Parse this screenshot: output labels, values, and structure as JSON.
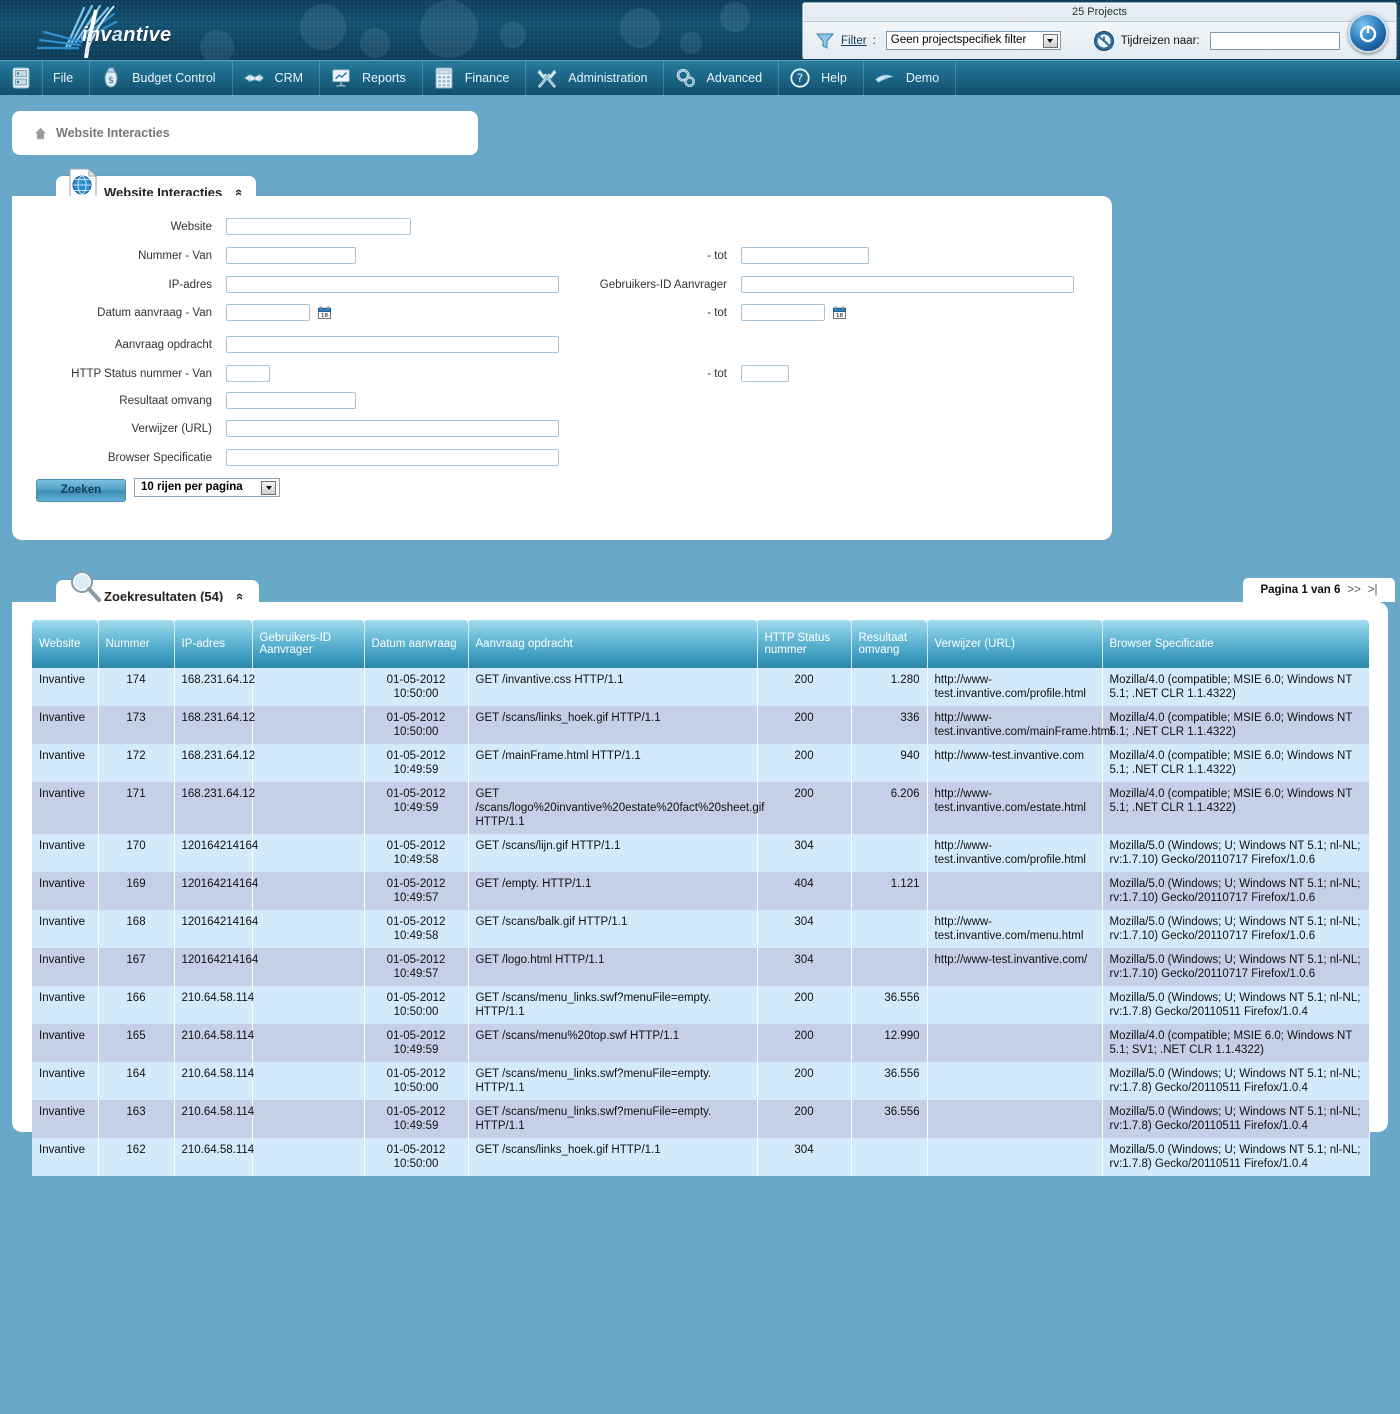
{
  "banner": {
    "logo_text_pre": "inv",
    "logo_text_swirl": "a",
    "logo_text_post": "ntive",
    "logo_full": "invantive"
  },
  "project_panel": {
    "title": "25 Projects",
    "filter_label": "Filter",
    "filter_colon": ":",
    "filter_value": "Geen projectspecifiek filter",
    "timetravel_label": "Tijdreizen naar:",
    "timetravel_value": "",
    "funnel_icon": "funnel-icon",
    "clock_icon": "clock-back-icon",
    "power_icon": "power-icon"
  },
  "menu": {
    "items": [
      {
        "label": "",
        "icon": "server-icon"
      },
      {
        "label": "File",
        "icon": ""
      },
      {
        "label": "Budget Control",
        "icon": "money-bag-icon"
      },
      {
        "label": "CRM",
        "icon": "handshake-icon"
      },
      {
        "label": "Reports",
        "icon": "presentation-chart-icon"
      },
      {
        "label": "Finance",
        "icon": "calculator-icon"
      },
      {
        "label": "Administration",
        "icon": "tools-icon"
      },
      {
        "label": "Advanced",
        "icon": "gears-icon"
      },
      {
        "label": "Help",
        "icon": "question-circle-icon"
      },
      {
        "label": "Demo",
        "icon": "bird-icon"
      }
    ]
  },
  "breadcrumb": {
    "home_icon": "home-icon",
    "text": "Website Interacties"
  },
  "search_panel": {
    "tab_title": "Website Interacties",
    "tab_icon": "globe-document-icon",
    "collapse_chevron": "«",
    "fields": {
      "website_label": "Website",
      "website_value": "",
      "nummer_van_label": "Nummer - Van",
      "nummer_van_value": "",
      "nummer_tot_label": "- tot",
      "nummer_tot_value": "",
      "ip_label": "IP-adres",
      "ip_value": "",
      "gebruikers_label": "Gebruikers-ID Aanvrager",
      "gebruikers_value": "",
      "datum_van_label": "Datum aanvraag - Van",
      "datum_van_value": "",
      "datum_tot_label": "- tot",
      "datum_tot_value": "",
      "opdracht_label": "Aanvraag opdracht",
      "opdracht_value": "",
      "http_van_label": "HTTP Status nummer - Van",
      "http_van_value": "",
      "http_tot_label": "- tot",
      "http_tot_value": "",
      "omvang_label": "Resultaat omvang",
      "omvang_value": "",
      "verwijzer_label": "Verwijzer (URL)",
      "verwijzer_value": "",
      "browser_label": "Browser Specificatie",
      "browser_value": ""
    },
    "search_button": "Zoeken",
    "rows_per_page": "10 rijen per pagina",
    "calendar_icon": "calendar-icon"
  },
  "results_panel": {
    "tab_title": "Zoekresultaten (54)",
    "tab_icon": "magnifier-icon",
    "collapse_chevron": "«",
    "pager_text": "Pagina 1 van 6",
    "pager_next": ">>",
    "pager_last": ">|",
    "columns": [
      "Website",
      "Nummer",
      "IP-adres",
      "Gebruikers-ID Aanvrager",
      "Datum aanvraag",
      "Aanvraag opdracht",
      "HTTP Status nummer",
      "Resultaat omvang",
      "Verwijzer (URL)",
      "Browser Specificatie"
    ],
    "rows": [
      {
        "website": "Invantive",
        "nummer": "174",
        "ip": "168.231.64.12",
        "gebruiker": "",
        "datum": "01-05-2012 10:50:00",
        "opdracht": "GET /invantive.css HTTP/1.1",
        "http": "200",
        "omvang": "1.280",
        "verwijzer": "http://www-test.invantive.com/profile.html",
        "browser": "Mozilla/4.0 (compatible; MSIE 6.0; Windows NT 5.1; .NET CLR 1.1.4322)"
      },
      {
        "website": "Invantive",
        "nummer": "173",
        "ip": "168.231.64.12",
        "gebruiker": "",
        "datum": "01-05-2012 10:50:00",
        "opdracht": "GET /scans/links_hoek.gif HTTP/1.1",
        "http": "200",
        "omvang": "336",
        "verwijzer": "http://www-test.invantive.com/mainFrame.html",
        "browser": "Mozilla/4.0 (compatible; MSIE 6.0; Windows NT 5.1; .NET CLR 1.1.4322)"
      },
      {
        "website": "Invantive",
        "nummer": "172",
        "ip": "168.231.64.12",
        "gebruiker": "",
        "datum": "01-05-2012 10:49:59",
        "opdracht": "GET /mainFrame.html HTTP/1.1",
        "http": "200",
        "omvang": "940",
        "verwijzer": "http://www-test.invantive.com",
        "browser": "Mozilla/4.0 (compatible; MSIE 6.0; Windows NT 5.1; .NET CLR 1.1.4322)"
      },
      {
        "website": "Invantive",
        "nummer": "171",
        "ip": "168.231.64.12",
        "gebruiker": "",
        "datum": "01-05-2012 10:49:59",
        "opdracht": "GET /scans/logo%20invantive%20estate%20fact%20sheet.gif HTTP/1.1",
        "http": "200",
        "omvang": "6.206",
        "verwijzer": "http://www-test.invantive.com/estate.html",
        "browser": "Mozilla/4.0 (compatible; MSIE 6.0; Windows NT 5.1; .NET CLR 1.1.4322)"
      },
      {
        "website": "Invantive",
        "nummer": "170",
        "ip": "120164214164",
        "gebruiker": "",
        "datum": "01-05-2012 10:49:58",
        "opdracht": "GET /scans/lijn.gif HTTP/1.1",
        "http": "304",
        "omvang": "",
        "verwijzer": "http://www-test.invantive.com/profile.html",
        "browser": "Mozilla/5.0 (Windows; U; Windows NT 5.1; nl-NL; rv:1.7.10) Gecko/20110717 Firefox/1.0.6"
      },
      {
        "website": "Invantive",
        "nummer": "169",
        "ip": "120164214164",
        "gebruiker": "",
        "datum": "01-05-2012 10:49:57",
        "opdracht": "GET /empty. HTTP/1.1",
        "http": "404",
        "omvang": "1.121",
        "verwijzer": "",
        "browser": "Mozilla/5.0 (Windows; U; Windows NT 5.1; nl-NL; rv:1.7.10) Gecko/20110717 Firefox/1.0.6"
      },
      {
        "website": "Invantive",
        "nummer": "168",
        "ip": "120164214164",
        "gebruiker": "",
        "datum": "01-05-2012 10:49:58",
        "opdracht": "GET /scans/balk.gif HTTP/1.1",
        "http": "304",
        "omvang": "",
        "verwijzer": "http://www-test.invantive.com/menu.html",
        "browser": "Mozilla/5.0 (Windows; U; Windows NT 5.1; nl-NL; rv:1.7.10) Gecko/20110717 Firefox/1.0.6"
      },
      {
        "website": "Invantive",
        "nummer": "167",
        "ip": "120164214164",
        "gebruiker": "",
        "datum": "01-05-2012 10:49:57",
        "opdracht": "GET /logo.html HTTP/1.1",
        "http": "304",
        "omvang": "",
        "verwijzer": "http://www-test.invantive.com/",
        "browser": "Mozilla/5.0 (Windows; U; Windows NT 5.1; nl-NL; rv:1.7.10) Gecko/20110717 Firefox/1.0.6"
      },
      {
        "website": "Invantive",
        "nummer": "166",
        "ip": "210.64.58.114",
        "gebruiker": "",
        "datum": "01-05-2012 10:50:00",
        "opdracht": "GET /scans/menu_links.swf?menuFile=empty. HTTP/1.1",
        "http": "200",
        "omvang": "36.556",
        "verwijzer": "",
        "browser": "Mozilla/5.0 (Windows; U; Windows NT 5.1; nl-NL; rv:1.7.8) Gecko/20110511 Firefox/1.0.4"
      },
      {
        "website": "Invantive",
        "nummer": "165",
        "ip": "210.64.58.114",
        "gebruiker": "",
        "datum": "01-05-2012 10:49:59",
        "opdracht": "GET /scans/menu%20top.swf HTTP/1.1",
        "http": "200",
        "omvang": "12.990",
        "verwijzer": "",
        "browser": "Mozilla/4.0 (compatible; MSIE 6.0; Windows NT 5.1; SV1; .NET CLR 1.1.4322)"
      },
      {
        "website": "Invantive",
        "nummer": "164",
        "ip": "210.64.58.114",
        "gebruiker": "",
        "datum": "01-05-2012 10:50:00",
        "opdracht": "GET /scans/menu_links.swf?menuFile=empty. HTTP/1.1",
        "http": "200",
        "omvang": "36.556",
        "verwijzer": "",
        "browser": "Mozilla/5.0 (Windows; U; Windows NT 5.1; nl-NL; rv:1.7.8) Gecko/20110511 Firefox/1.0.4"
      },
      {
        "website": "Invantive",
        "nummer": "163",
        "ip": "210.64.58.114",
        "gebruiker": "",
        "datum": "01-05-2012 10:49:59",
        "opdracht": "GET /scans/menu_links.swf?menuFile=empty. HTTP/1.1",
        "http": "200",
        "omvang": "36.556",
        "verwijzer": "",
        "browser": "Mozilla/5.0 (Windows; U; Windows NT 5.1; nl-NL; rv:1.7.8) Gecko/20110511 Firefox/1.0.4"
      },
      {
        "website": "Invantive",
        "nummer": "162",
        "ip": "210.64.58.114",
        "gebruiker": "",
        "datum": "01-05-2012 10:50:00",
        "opdracht": "GET /scans/links_hoek.gif HTTP/1.1",
        "http": "304",
        "omvang": "",
        "verwijzer": "",
        "browser": "Mozilla/5.0 (Windows; U; Windows NT 5.1; nl-NL; rv:1.7.8) Gecko/20110511 Firefox/1.0.4"
      }
    ]
  },
  "colors": {
    "page_background": "#6aa8ca",
    "banner_dark": "#0d3e5c",
    "menu_teal": "#1d6b8c",
    "header_blue": "#3e9cbe",
    "row_odd": "#d3eafb",
    "row_even": "#c6cfe8"
  }
}
